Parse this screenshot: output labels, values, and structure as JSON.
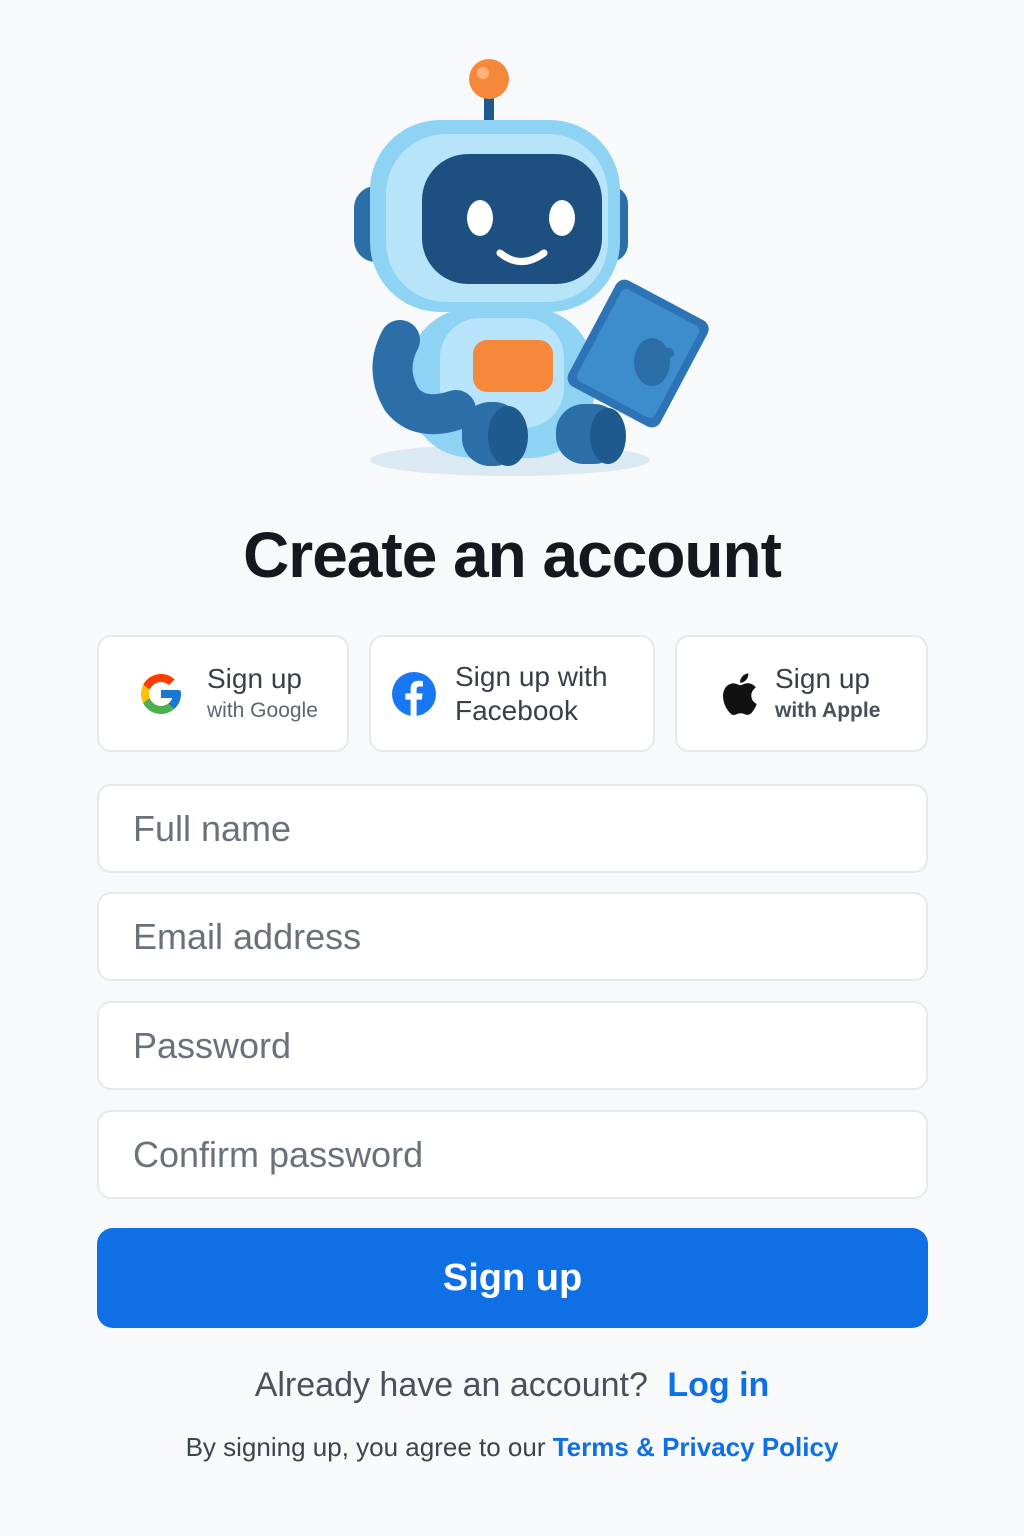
{
  "title": "Create an account",
  "social": {
    "google": {
      "line1": "Sign up",
      "line2": "with Google"
    },
    "facebook": {
      "line1": "Sign up with",
      "line2": "Facebook"
    },
    "apple": {
      "line1": "Sign up",
      "line2": "with Apple"
    }
  },
  "fields": {
    "full_name": {
      "placeholder": "Full name"
    },
    "email": {
      "placeholder": "Email address"
    },
    "password": {
      "placeholder": "Password"
    },
    "confirm_password": {
      "placeholder": "Confirm password"
    }
  },
  "submit_label": "Sign up",
  "login": {
    "prompt": "Already have an account?",
    "link": "Log in"
  },
  "terms": {
    "prefix": "By signing up, you agree to our",
    "link": "Terms & Privacy Policy"
  },
  "colors": {
    "primary": "#0f6fe4",
    "background": "#f7f9fb",
    "robot_body": "#8fd3f4",
    "robot_dark": "#1d4f80",
    "robot_accent": "#f5883a"
  },
  "icons": {
    "mascot": "robot-mascot-with-tablet",
    "google": "google-logo-icon",
    "facebook": "facebook-logo-icon",
    "apple": "apple-logo-icon"
  }
}
